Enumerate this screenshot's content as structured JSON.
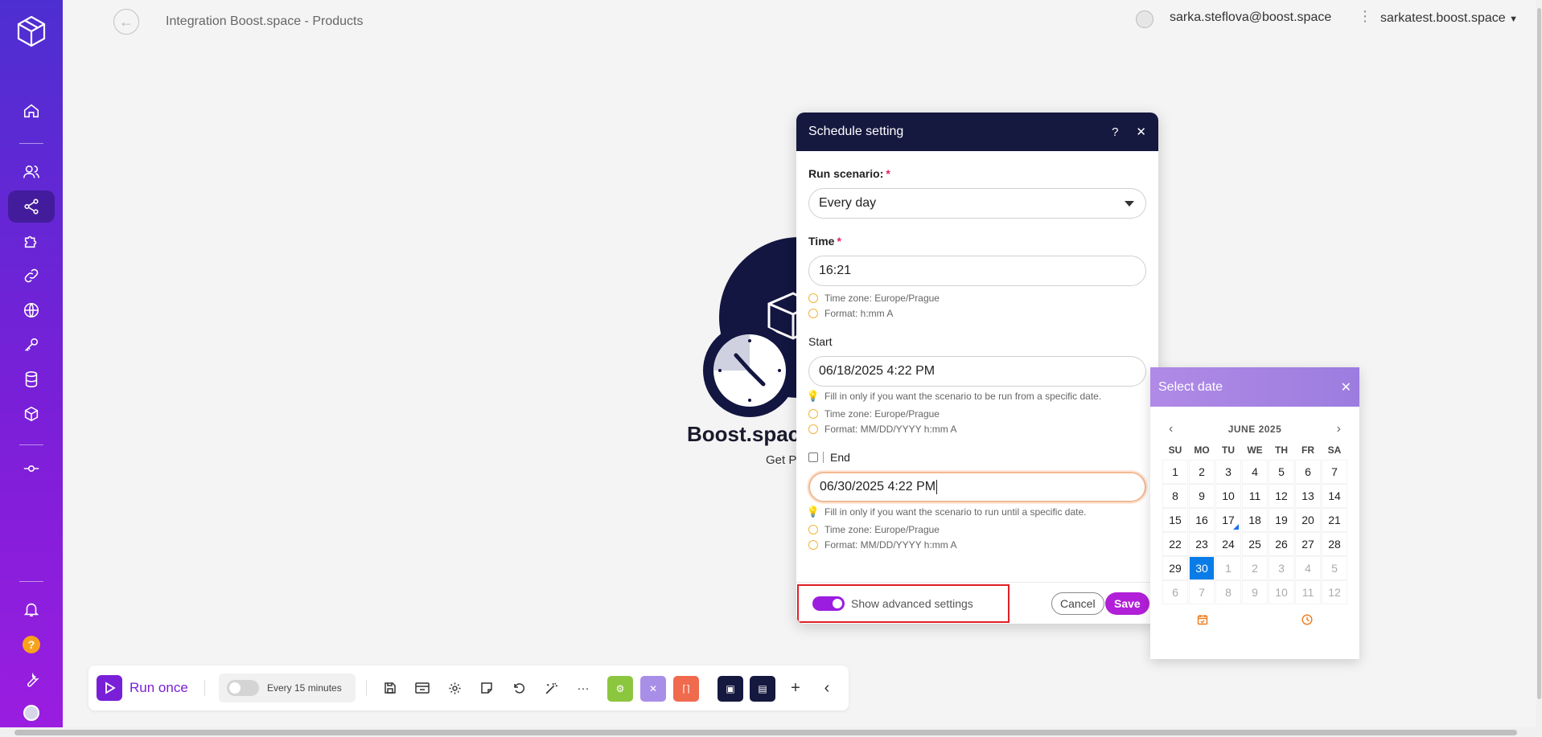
{
  "header": {
    "title": "Integration Boost.space - Products",
    "user_email": "sarka.steflova@boost.space",
    "org_name": "sarkatest.boost.space"
  },
  "node": {
    "title": "Boost.space",
    "subtitle": "Get P"
  },
  "dialog": {
    "title": "Schedule setting",
    "help": "?",
    "close": "✕",
    "run_scenario_label": "Run scenario:",
    "run_scenario_value": "Every day",
    "time_label": "Time",
    "time_value": "16:21",
    "time_hints": [
      "Time zone: Europe/Prague",
      "Format: h:mm A"
    ],
    "start_label": "Start",
    "start_value": "06/18/2025 4:22 PM",
    "start_hint": "Fill in only if you want the scenario to be run from a specific date.",
    "start_hints": [
      "Time zone: Europe/Prague",
      "Format: MM/DD/YYYY h:mm A"
    ],
    "end_label": "End",
    "end_value": "06/30/2025 4:22 PM",
    "end_hint": "Fill in only if you want the scenario to run until a specific date.",
    "end_hints": [
      "Time zone: Europe/Prague",
      "Format: MM/DD/YYYY h:mm A"
    ],
    "advanced_label": "Show advanced settings",
    "advanced_on": true,
    "cancel_label": "Cancel",
    "save_label": "Save"
  },
  "datepicker": {
    "title": "Select date",
    "close": "✕",
    "month": "JUNE 2025",
    "weekdays": [
      "SU",
      "MO",
      "TU",
      "WE",
      "TH",
      "FR",
      "SA"
    ],
    "weeks": [
      [
        "1",
        "2",
        "3",
        "4",
        "5",
        "6",
        "7"
      ],
      [
        "8",
        "9",
        "10",
        "11",
        "12",
        "13",
        "14"
      ],
      [
        "15",
        "16",
        "17",
        "18",
        "19",
        "20",
        "21"
      ],
      [
        "22",
        "23",
        "24",
        "25",
        "26",
        "27",
        "28"
      ],
      [
        "29",
        "30",
        "1",
        "2",
        "3",
        "4",
        "5"
      ],
      [
        "6",
        "7",
        "8",
        "9",
        "10",
        "11",
        "12"
      ]
    ],
    "selected_day": "30",
    "today_day": "17"
  },
  "toolbar": {
    "run_label": "Run once",
    "schedule_label": "Every 15 minutes"
  },
  "colors": {
    "accent": "#7a1fd8",
    "dialog_header": "#15183f",
    "selected_date": "#0a7ce8",
    "highlight_box": "#e01f26"
  }
}
